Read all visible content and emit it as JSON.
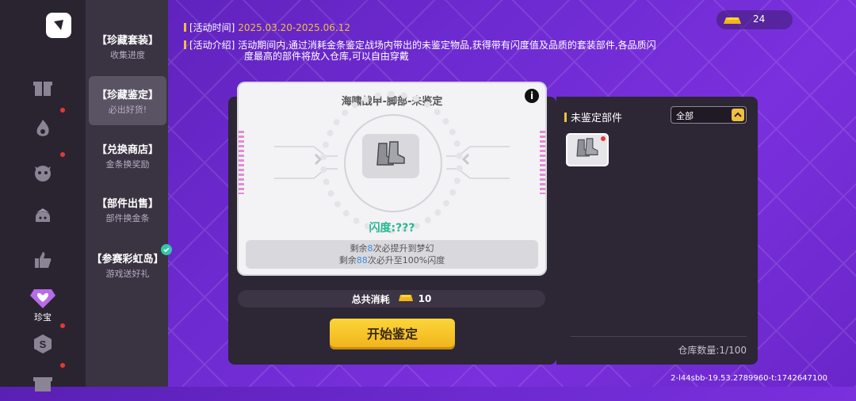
{
  "rail": {
    "active_label": "珍宝",
    "icons": [
      "logo-icon",
      "gift-icon",
      "flame-icon",
      "tiger-icon",
      "hero-icon",
      "thumbs-up-icon",
      "gem-heart-icon",
      "s-coin-icon",
      "box-icon"
    ]
  },
  "menu": {
    "items": [
      {
        "title": "【珍藏套装】",
        "subtitle": "收集进度"
      },
      {
        "title": "【珍藏鉴定】",
        "subtitle": "必出好货!"
      },
      {
        "title": "【兑换商店】",
        "subtitle": "金条换奖励"
      },
      {
        "title": "【部件出售】",
        "subtitle": "部件换金条"
      },
      {
        "title": "【参赛彩虹岛】",
        "subtitle": "游戏送好礼"
      }
    ]
  },
  "event": {
    "time_label": "[活动时间]",
    "time_value": "2025.03.20-2025.06.12",
    "intro_label": "[活动介绍]",
    "intro_line1": "活动期间内,通过消耗金条鉴定战场内带出的未鉴定物品,获得带有闪度值及品质的套装部件,各品质闪",
    "intro_line2": "度最高的部件将放入仓库,可以自由穿戴"
  },
  "currency": {
    "value": "24",
    "icon": "gold-bar-icon"
  },
  "card": {
    "title": "海啸战甲-脚部-未鉴定",
    "flash": "闪度:???",
    "remaining1_prefix": "剩余",
    "remaining1_num": "8",
    "remaining1_suffix": "次必提升到梦幻",
    "remaining2_prefix": "剩余",
    "remaining2_num": "88",
    "remaining2_suffix": "次必升至100%闪度"
  },
  "cost": {
    "label": "总共消耗",
    "value": "10"
  },
  "start_button": "开始鉴定",
  "right_panel": {
    "title": "未鉴定部件",
    "filter_value": "全部",
    "storage": "仓库数量:1/100"
  },
  "version": "2-l44sbb-19.53.2789960-t:1742647100",
  "colors": {
    "accent": "#f0c040",
    "flash": "#26b894",
    "background": "#6a26c9"
  }
}
